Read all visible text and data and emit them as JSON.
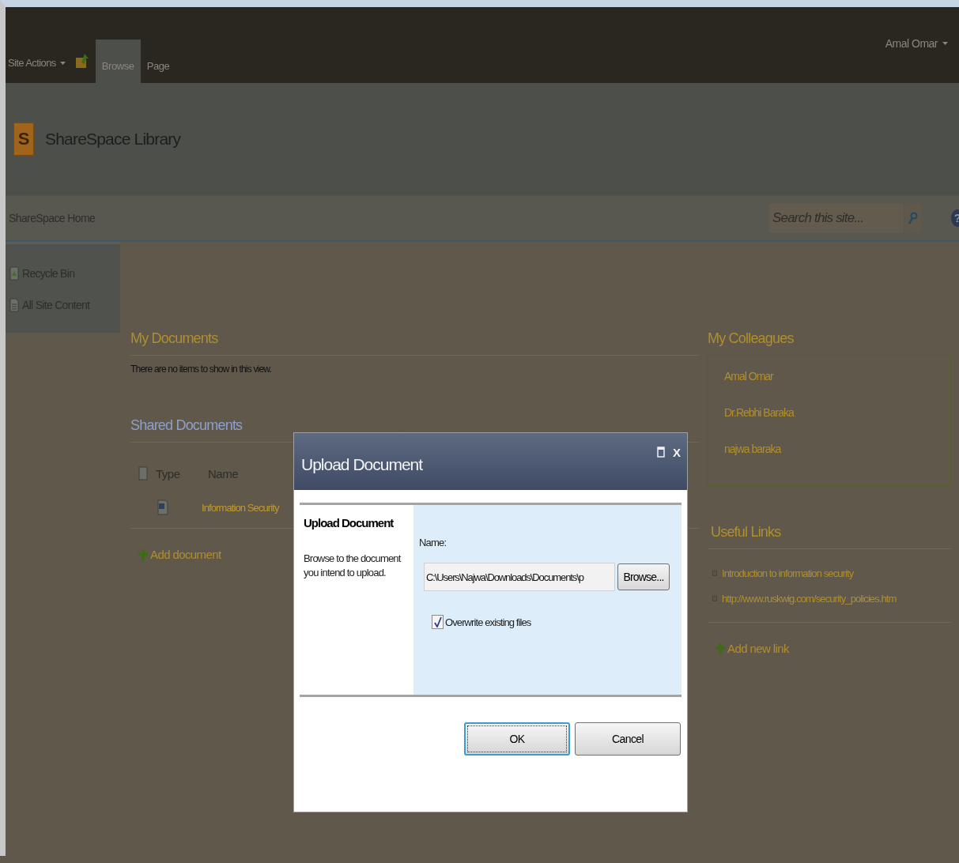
{
  "ribbon": {
    "site_actions": "Site Actions",
    "tabs": [
      {
        "label": "Browse",
        "selected": true
      },
      {
        "label": "Page",
        "selected": false
      }
    ],
    "user": "Amal Omar"
  },
  "header": {
    "logo_letter": "S",
    "title": "ShareSpace Library"
  },
  "nav": {
    "home": "ShareSpace Home",
    "search": {
      "placeholder": "Search this site..."
    },
    "help": "?"
  },
  "quick_launch": [
    {
      "label": "Recycle Bin",
      "kind": "recycle"
    },
    {
      "label": "All Site Content",
      "kind": "content"
    }
  ],
  "my_documents": {
    "title": "My Documents",
    "empty_message": "There are no items to show in this view."
  },
  "shared_documents": {
    "title": "Shared Documents",
    "columns": [
      "Type",
      "Name"
    ],
    "rows": [
      {
        "name": "Information Security"
      }
    ],
    "add": "Add document"
  },
  "my_colleagues": {
    "title": "My Colleagues",
    "people": [
      "Amal Omar",
      "Dr.Rebhi Baraka",
      "najwa baraka"
    ]
  },
  "useful_links": {
    "title": "Useful Links",
    "links": [
      "Introduction to information security",
      "http://www.ruskwig.com/security_policies.htm"
    ],
    "add": "Add new link"
  },
  "dialog": {
    "title": "Upload Document",
    "close": "X",
    "section_title": "Upload Document",
    "description": "Browse to the document you intend to upload.",
    "name_label": "Name:",
    "file_value": "C:\\Users\\Najwa\\Downloads\\Documents\\p",
    "browse": "Browse...",
    "overwrite": {
      "label": "Overwrite existing files",
      "checked": true
    },
    "buttons": [
      {
        "label": "OK",
        "default": true
      },
      {
        "label": "Cancel",
        "default": false
      }
    ]
  }
}
